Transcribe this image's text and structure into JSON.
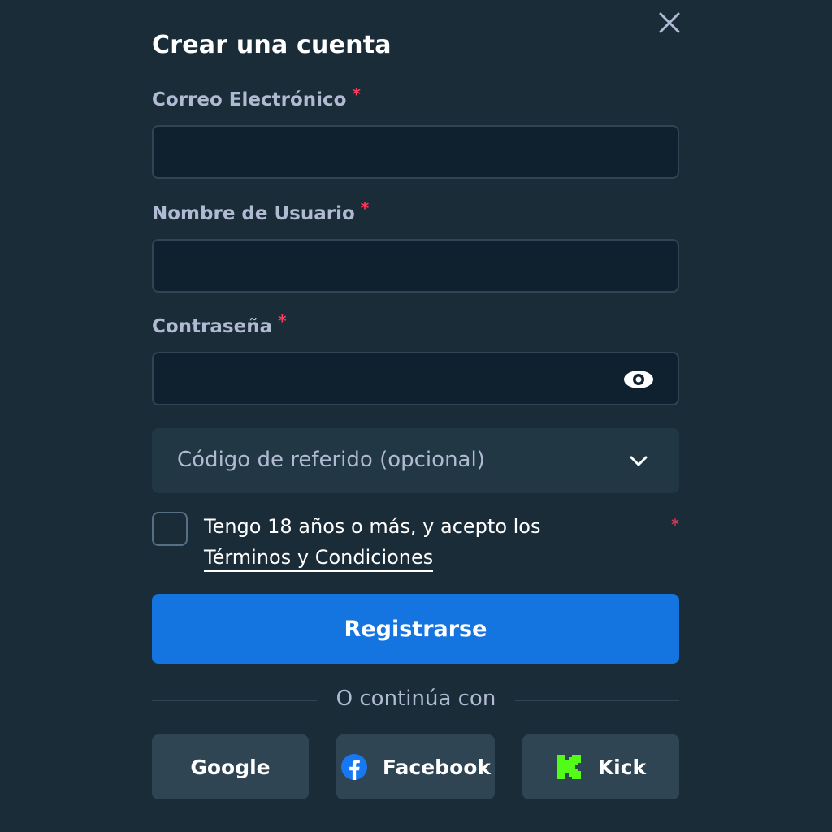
{
  "modal": {
    "title": "Crear una cuenta"
  },
  "fields": {
    "email": {
      "label": "Correo Electrónico",
      "required_mark": "*",
      "value": ""
    },
    "username": {
      "label": "Nombre de Usuario",
      "required_mark": "*",
      "value": ""
    },
    "password": {
      "label": "Contraseña",
      "required_mark": "*",
      "value": ""
    }
  },
  "referral": {
    "label": "Código de referido (opcional)"
  },
  "terms": {
    "text": "Tengo 18 años o más, y acepto los",
    "link": "Términos y Condiciones",
    "required_mark": "*",
    "checked": false
  },
  "submit": {
    "label": "Registrarse"
  },
  "divider": {
    "text": "O continúa con"
  },
  "social": {
    "google": {
      "label": "Google"
    },
    "facebook": {
      "label": "Facebook",
      "icon": "facebook-icon",
      "color": "#1877f2"
    },
    "kick": {
      "label": "Kick",
      "icon": "kick-icon",
      "color": "#53fc18"
    }
  },
  "colors": {
    "background": "#1a2c38",
    "input_background": "#0f212e",
    "input_border": "#2f4553",
    "label": "#b1bad3",
    "required": "#ff3b5c",
    "primary_button": "#1475e1",
    "social_button": "#2f4553"
  }
}
